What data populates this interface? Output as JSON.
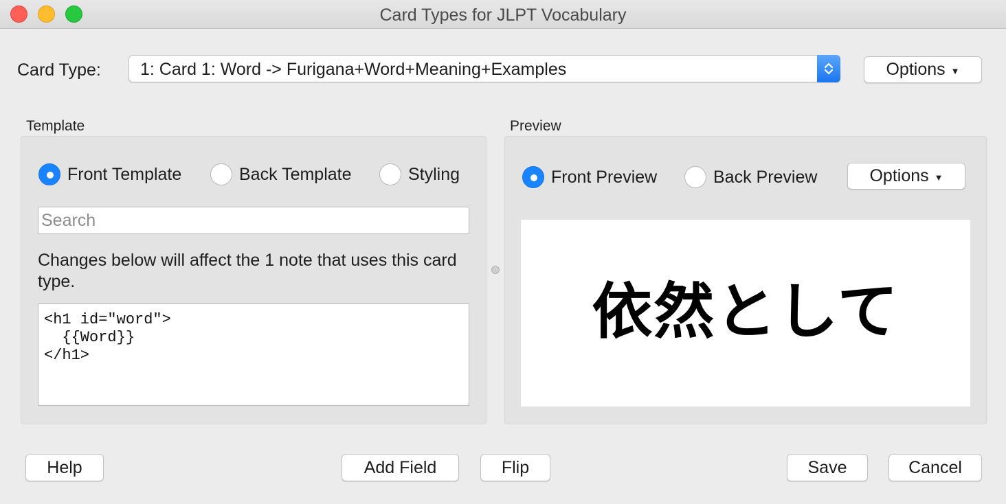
{
  "window": {
    "title": "Card Types for JLPT Vocabulary"
  },
  "card_type": {
    "label": "Card Type:",
    "selected": "1: Card 1: Word -> Furigana+Word+Meaning+Examples",
    "options_label": "Options"
  },
  "template": {
    "section_label": "Template",
    "radios": [
      {
        "label": "Front Template",
        "checked": true
      },
      {
        "label": "Back Template",
        "checked": false
      },
      {
        "label": "Styling",
        "checked": false
      }
    ],
    "search_placeholder": "Search",
    "note": "Changes below will affect the 1 note that uses this card type.",
    "code": "<h1 id=\"word\">\n  {{Word}}\n</h1>"
  },
  "preview": {
    "section_label": "Preview",
    "radios": [
      {
        "label": "Front Preview",
        "checked": true
      },
      {
        "label": "Back Preview",
        "checked": false
      }
    ],
    "options_label": "Options",
    "word": "依然として"
  },
  "footer": {
    "help": "Help",
    "add_field": "Add Field",
    "flip": "Flip",
    "save": "Save",
    "cancel": "Cancel"
  },
  "colors": {
    "accent": "#1a83ff",
    "background": "#ececec",
    "panel": "#e3e3e3"
  }
}
